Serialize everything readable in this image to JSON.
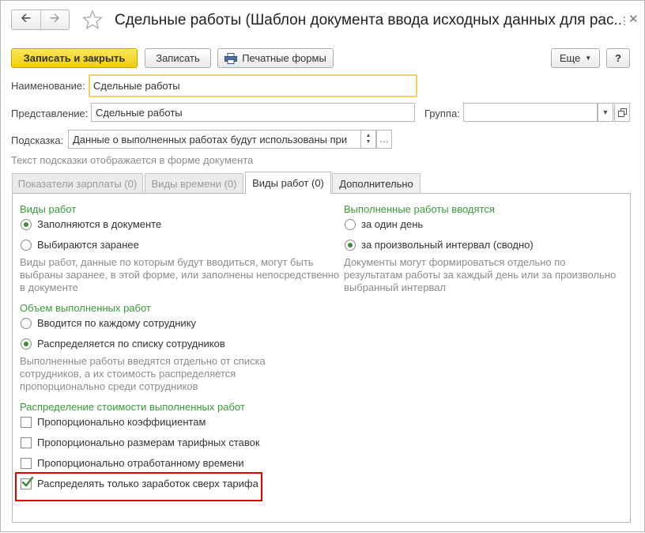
{
  "window": {
    "title": "Сдельные работы (Шаблон документа ввода исходных данных для рас..."
  },
  "toolbar": {
    "save_close_label": "Записать и закрыть",
    "save_label": "Записать",
    "print_label": "Печатные формы",
    "more_label": "Еще",
    "help_label": "?"
  },
  "form": {
    "name_label": "Наименование:",
    "name_value": "Сдельные работы",
    "repr_label": "Представление:",
    "repr_value": "Сдельные работы",
    "group_label": "Группа:",
    "group_value": "",
    "tip_label": "Подсказка:",
    "tip_value": "Данные о выполненных работах будут использованы при",
    "tip_note": "Текст подсказки отображается в форме документа"
  },
  "tabs": [
    {
      "label": "Показатели зарплаты (0)",
      "state": "disabled"
    },
    {
      "label": "Виды времени (0)",
      "state": "disabled"
    },
    {
      "label": "Виды работ (0)",
      "state": "active"
    },
    {
      "label": "Дополнительно",
      "state": "normal"
    }
  ],
  "work_types": {
    "title": "Виды работ",
    "options": [
      "Заполняются в документе",
      "Выбираются заранее"
    ],
    "selected": 0,
    "desc": [
      "Виды работ, данные по которым будут вводиться, могут быть",
      "выбраны заранее, в этой форме, или заполнены непосредственно",
      "в документе"
    ]
  },
  "entry_mode": {
    "title": "Выполненные работы вводятся",
    "options": [
      "за один день",
      "за произвольный интервал (сводно)"
    ],
    "selected": 1,
    "desc": [
      "Документы могут формироваться отдельно по",
      "результатам работы за каждый день или за произвольно",
      "выбранный интервал"
    ]
  },
  "volume": {
    "title": "Объем выполненных работ",
    "options": [
      "Вводится по каждому сотруднику",
      "Распределяется по списку сотрудников"
    ],
    "selected": 1,
    "desc": [
      "Выполненные работы введятся отдельно от списка",
      "сотрудников, а их стоимость распределяется",
      "пропорционально среди сотрудников"
    ]
  },
  "distribution": {
    "title": "Распределение стоимости выполненных работ",
    "checks": [
      {
        "label": "Пропорционально коэффициентам",
        "checked": false
      },
      {
        "label": "Пропорционально размерам тарифных ставок",
        "checked": false
      },
      {
        "label": "Пропорционально отработанному времени",
        "checked": false
      },
      {
        "label": "Распределять только заработок сверх тарифа",
        "checked": true
      }
    ]
  },
  "colors": {
    "primary_button": "#f4d21f",
    "group_title": "#3a9a3a",
    "highlight": "#e00000"
  }
}
